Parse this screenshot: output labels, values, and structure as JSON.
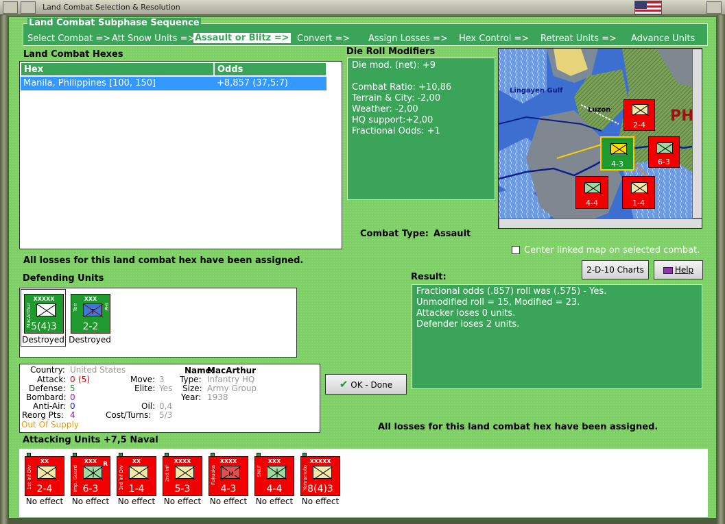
{
  "window": {
    "title": "Land Combat Selection & Resolution"
  },
  "sequence": {
    "title": "Land Combat Subphase Sequence",
    "steps": [
      {
        "label": "Select Combat =>",
        "active": false
      },
      {
        "label": "Att Snow Units =>",
        "active": false
      },
      {
        "label": "Assault or Blitz =>",
        "active": true
      },
      {
        "label": "Convert =>",
        "active": false
      },
      {
        "label": "Assign Losses =>",
        "active": false
      },
      {
        "label": "Hex Control =>",
        "active": false
      },
      {
        "label": "Retreat Units =>",
        "active": false
      },
      {
        "label": "Advance Units",
        "active": false
      }
    ]
  },
  "hexes": {
    "title": "Land Combat Hexes",
    "columns": [
      "Hex",
      "Odds"
    ],
    "rows": [
      {
        "hex": "Manila, Philippines [100, 150]",
        "odds": "+8,857 (37,5:7)"
      }
    ]
  },
  "modifiers": {
    "title": "Die Roll Modifiers",
    "lines": [
      "Die mod. (net): +9",
      "",
      "Combat Ratio: +10,86",
      "Terrain & City: -2,00",
      "Weather: -2,00",
      "HQ support:+2,00",
      "Fractional Odds: +1"
    ]
  },
  "map": {
    "labels": {
      "gulf": "Lingayen Gulf",
      "island": "Luzon",
      "country": "PH"
    }
  },
  "combat_type": {
    "label": "Combat Type:",
    "value": "Assault"
  },
  "center_map": {
    "label": "Center linked map on selected combat.",
    "checked": false
  },
  "losses_msg": "All losses for this land combat hex have been assigned.",
  "buttons": {
    "charts": "2-D-10 Charts",
    "help": "Help",
    "ok": "OK - Done"
  },
  "result": {
    "title": "Result:",
    "lines": [
      "Fractional odds (.857) roll was (.575)  - Yes.",
      "Unmodified roll = 15, Modified = 23.",
      "Attacker loses 0 units.",
      "Defender loses 2 units."
    ]
  },
  "defending": {
    "title": "Defending Units",
    "units": [
      {
        "size": "XXXXX",
        "strength": "5(4)3",
        "side": "MacArthur",
        "caption": "Destroyed",
        "color": "green",
        "type": "infantry"
      },
      {
        "size": "XXX",
        "strength": "2-2",
        "side": "Terr",
        "side2": "PHI",
        "caption": "Destroyed",
        "color": "green",
        "type": "territorial"
      }
    ]
  },
  "unit_info": {
    "country_label": "Country:",
    "country": "United States",
    "attack_label": "Attack:",
    "attack": "0",
    "attack_paren": "(5)",
    "defense_label": "Defense:",
    "defense": "5",
    "bombard_label": "Bombard:",
    "bombard": "0",
    "antiair_label": "Anti-Air:",
    "antiair": "0",
    "reorg_label": "Reorg Pts:",
    "reorg": "4",
    "supply": "Out Of Supply",
    "move_label": "Move:",
    "move": "3",
    "elite_label": "Elite:",
    "elite": "Yes",
    "oil_label": "Oil:",
    "oil": "0,4",
    "cost_label": "Cost/Turns:",
    "cost": "5/3",
    "name_label": "Name:",
    "name": "MacArthur",
    "type_label": "Type:",
    "type": "Infantry HQ",
    "size_label": "Size:",
    "size": "Army Group",
    "year_label": "Year:",
    "year": "1938"
  },
  "attacking": {
    "title": "Attacking Units +7,5 Naval",
    "units": [
      {
        "size": "XX",
        "strength": "2-4",
        "side": "1st Inf Div",
        "caption": "No effect",
        "type": "infantry"
      },
      {
        "size": "XXX",
        "strength": "6-3",
        "side": "Imp. Guard",
        "caption": "No effect",
        "type": "marine",
        "flag": "R"
      },
      {
        "size": "XX",
        "strength": "1-4",
        "side": "3rd Inf Div",
        "caption": "No effect",
        "type": "infantry"
      },
      {
        "size": "XXXX",
        "strength": "5-3",
        "side": "2nd Inf",
        "caption": "No effect",
        "type": "infantry"
      },
      {
        "size": "XXXX",
        "strength": "4-3",
        "side": "Fukuoka",
        "caption": "No effect",
        "type": "mountain"
      },
      {
        "size": "XXX",
        "strength": "4-4",
        "side": "SNLF",
        "caption": "No effect",
        "type": "marine"
      },
      {
        "size": "XXXXX",
        "strength": "8(4)3",
        "side": "Yamamoto",
        "caption": "No effect",
        "type": "infantry"
      }
    ]
  },
  "colors": {
    "panel_green": "#3aa558",
    "bg_green": "#7dcf66",
    "attack_red": "#f00000",
    "defend_green": "#1e9a2e",
    "select_blue": "#3399ff"
  }
}
